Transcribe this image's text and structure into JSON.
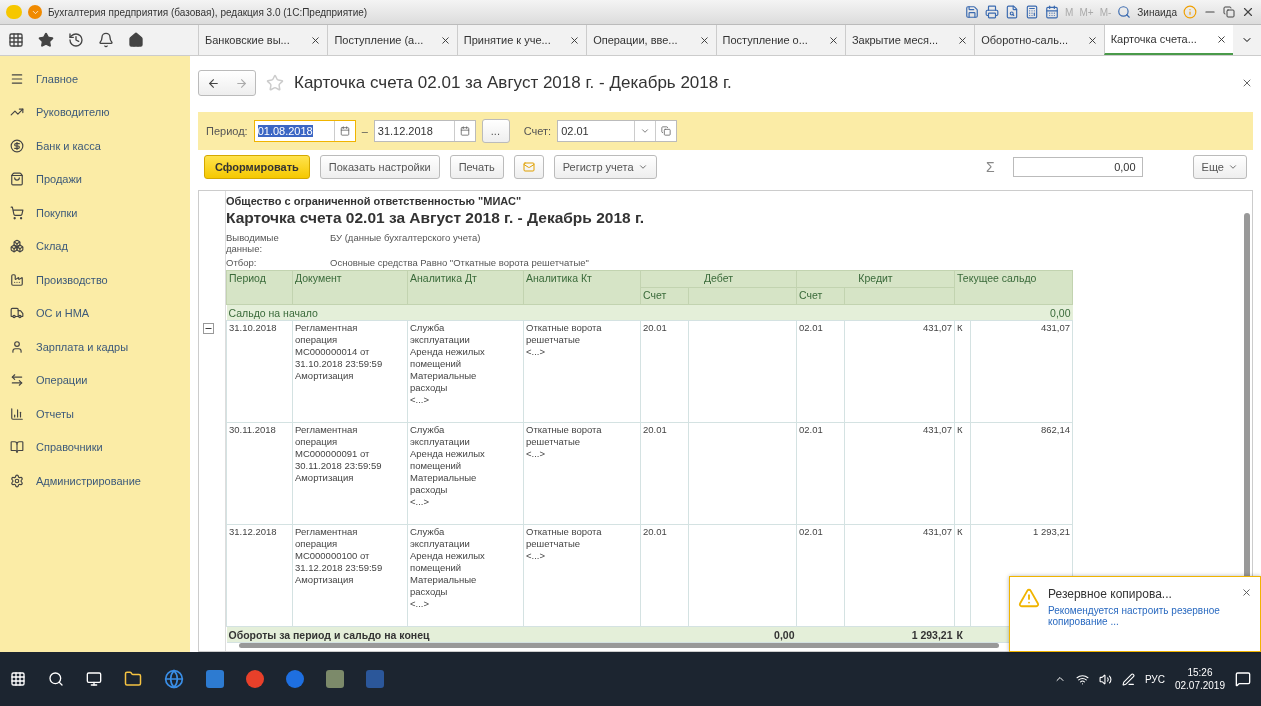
{
  "window": {
    "title": "Бухгалтерия предприятия (базовая), редакция 3.0  (1С:Предприятие)",
    "memory_buttons": [
      "M",
      "M+",
      "M-"
    ],
    "user": "Зинаида"
  },
  "open_tabs": [
    {
      "label": "Банковские вы...",
      "selected": false
    },
    {
      "label": "Поступление (а...",
      "selected": false
    },
    {
      "label": "Принятие к уче...",
      "selected": false
    },
    {
      "label": "Операции, вве...",
      "selected": false
    },
    {
      "label": "Поступление о...",
      "selected": false
    },
    {
      "label": "Закрытие меся...",
      "selected": false
    },
    {
      "label": "Оборотно-саль...",
      "selected": false
    },
    {
      "label": "Карточка счета...",
      "selected": true
    }
  ],
  "sidebar": {
    "items": [
      {
        "kind": "main",
        "label": "Главное"
      },
      {
        "kind": "manager",
        "label": "Руководителю"
      },
      {
        "kind": "bank",
        "label": "Банк и касса"
      },
      {
        "kind": "sales",
        "label": "Продажи"
      },
      {
        "kind": "purchases",
        "label": "Покупки"
      },
      {
        "kind": "warehouse",
        "label": "Склад"
      },
      {
        "kind": "production",
        "label": "Производство"
      },
      {
        "kind": "assets",
        "label": "ОС и НМА"
      },
      {
        "kind": "staff",
        "label": "Зарплата и кадры"
      },
      {
        "kind": "operations",
        "label": "Операции"
      },
      {
        "kind": "reports",
        "label": "Отчеты"
      },
      {
        "kind": "catalogs",
        "label": "Справочники"
      },
      {
        "kind": "admin",
        "label": "Администрирование"
      }
    ]
  },
  "form": {
    "title": "Карточка счета 02.01 за Август 2018 г. - Декабрь 2018 г.",
    "period": {
      "label": "Период:",
      "from": "01.08.2018",
      "from_highlighted": true,
      "dash": "–",
      "to": "31.12.2018"
    },
    "ellipsis": "...",
    "account": {
      "label": "Счет:",
      "value": "02.01"
    },
    "buttons": {
      "generate": "Сформировать",
      "settings": "Показать настройки",
      "print": "Печать",
      "register": "Регистр учета",
      "more": "Еще"
    },
    "sum_sign": "Σ",
    "sum": "0,00"
  },
  "report": {
    "organization": "Общество с ограниченной ответственностью \"МИАС\"",
    "title": "Карточка счета 02.01 за Август 2018 г. - Декабрь 2018 г.",
    "params": [
      {
        "label": "Выводимые данные:",
        "value": "БУ (данные бухгалтерского учета)"
      },
      {
        "label": "Отбор:",
        "value": "Основные средства Равно \"Откатные ворота решетчатые\""
      }
    ],
    "columns": {
      "period": "Период",
      "document": "Документ",
      "analytics_dt": "Аналитика Дт",
      "analytics_kt": "Аналитика Кт",
      "debit": "Дебет",
      "debit_account": "Счет",
      "credit": "Кредит",
      "credit_account": "Счет",
      "balance": "Текущее сальдо"
    },
    "opening": {
      "label": "Сальдо на начало",
      "balance": "0,00",
      "expanded": true
    },
    "rows": [
      {
        "period": "31.10.2018",
        "document": [
          "Регламентная",
          "операция",
          "МС000000014 от",
          "31.10.2018 23:59:59",
          "Амортизация"
        ],
        "analytics_dt": [
          "Служба",
          "эксплуатации",
          "Аренда нежилых",
          "помещений",
          "Материальные",
          "расходы",
          "<...>"
        ],
        "analytics_kt": [
          "Откатные ворота",
          "решетчатые",
          "<...>"
        ],
        "debit_account": "20.01",
        "credit_account": "02.01",
        "credit_sum": "431,07",
        "balance_side": "К",
        "balance": "431,07"
      },
      {
        "period": "30.11.2018",
        "document": [
          "Регламентная",
          "операция",
          "МС000000091 от",
          "30.11.2018 23:59:59",
          "Амортизация"
        ],
        "analytics_dt": [
          "Служба",
          "эксплуатации",
          "Аренда нежилых",
          "помещений",
          "Материальные",
          "расходы",
          "<...>"
        ],
        "analytics_kt": [
          "Откатные ворота",
          "решетчатые",
          "<...>"
        ],
        "debit_account": "20.01",
        "credit_account": "02.01",
        "credit_sum": "431,07",
        "balance_side": "К",
        "balance": "862,14"
      },
      {
        "period": "31.12.2018",
        "document": [
          "Регламентная",
          "операция",
          "МС000000100 от",
          "31.12.2018 23:59:59",
          "Амортизация"
        ],
        "analytics_dt": [
          "Служба",
          "эксплуатации",
          "Аренда нежилых",
          "помещений",
          "Материальные",
          "расходы",
          "<...>"
        ],
        "analytics_kt": [
          "Откатные ворота",
          "решетчатые",
          "<...>"
        ],
        "debit_account": "20.01",
        "credit_account": "02.01",
        "credit_sum": "431,07",
        "balance_side": "К",
        "balance": "1 293,21"
      }
    ],
    "totals": {
      "label": "Обороты за период и сальдо на конец",
      "debit_sum": "0,00",
      "credit_sum": "1 293,21",
      "balance_side": "К"
    }
  },
  "notification": {
    "title": "Резервное копирова...",
    "text": "Рекомендуется настроить резервное копирование ..."
  },
  "taskbar": {
    "language": "РУС",
    "time": "15:26",
    "date": "02.07.2019"
  }
}
